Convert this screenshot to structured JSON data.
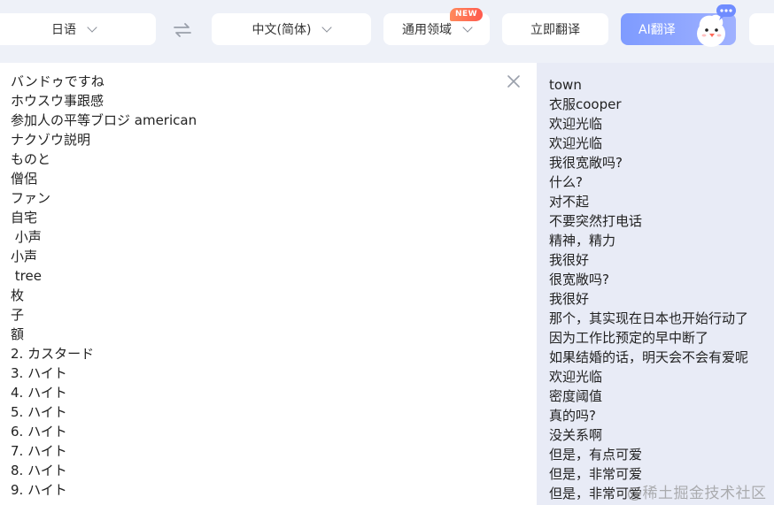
{
  "toolbar": {
    "source_lang": "日语",
    "target_lang": "中文(简体)",
    "domain": "通用领域",
    "domain_badge": "NEW",
    "translate_now": "立即翻译",
    "ai_translate": "AI翻译"
  },
  "source_lines": [
    "バンドゥですね",
    "ホウスウ事跟感",
    "参加人の平等ブロジ american",
    "ナクゾウ説明",
    "ものと",
    "僧侶",
    "ファン",
    "自宅",
    " 小声",
    "小声",
    " tree",
    "枚",
    "子",
    "額",
    "2. カスタード",
    "3. ハイト",
    "4. ハイト",
    "5. ハイト",
    "6. ハイト",
    "7. ハイト",
    "8. ハイト",
    "9. ハイト"
  ],
  "translation_lines": [
    "town",
    "衣服cooper",
    "欢迎光临",
    "欢迎光临",
    "我很宽敞吗?",
    "什么?",
    "对不起",
    "不要突然打电话",
    "精神，精力",
    "我很好",
    "很宽敞吗?",
    "我很好",
    "那个，其实现在日本也开始行动了",
    "因为工作比预定的早中断了",
    "如果结婚的话，明天会不会有爱呢",
    "欢迎光临",
    "密度阈值",
    "真的吗?",
    "没关系啊",
    "但是，有点可爱",
    "但是，非常可爱",
    "但是，非常可爱"
  ],
  "watermark": "@稀土掘金技术社区",
  "colors": {
    "background": "#eef1f8",
    "ai_gradient_start": "#7e9bff",
    "badge_gradient": "#ff5a4e",
    "result_panel": "#e8ebf6"
  }
}
